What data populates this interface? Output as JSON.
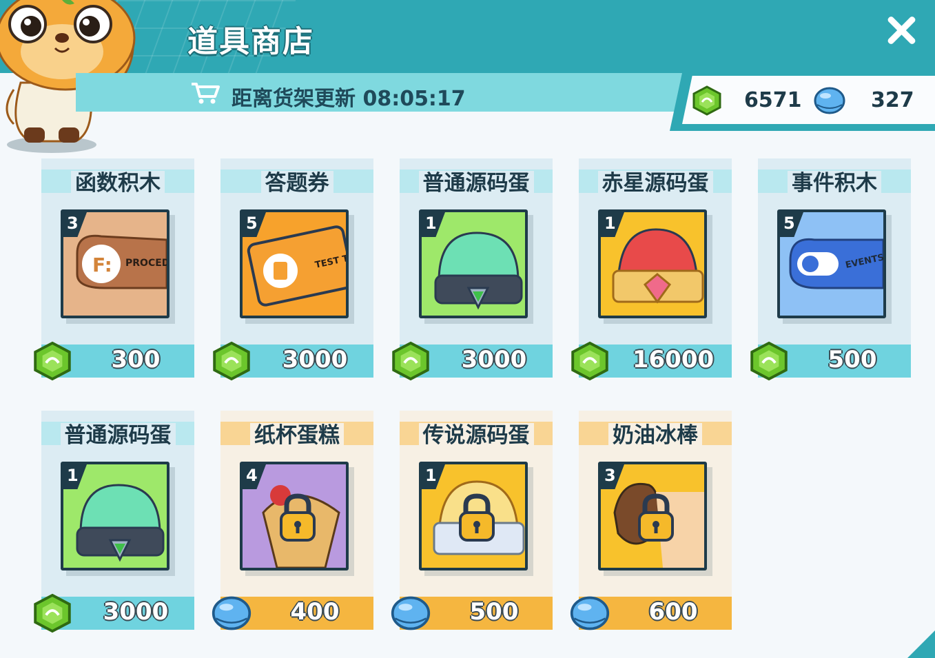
{
  "header": {
    "title": "道具商店",
    "refresh_text": "距离货架更新 08:05:17"
  },
  "currency": {
    "gems": "6571",
    "orbs": "327"
  },
  "colors": {
    "teal": "#2fa8b4",
    "light_teal": "#7fd9df",
    "price_blue": "#6fd3df",
    "price_orange": "#f5b640",
    "dark": "#1e3b49"
  },
  "items": [
    {
      "name": "函数积木",
      "count": "3",
      "price": "300",
      "currency_icon": "gem-icon",
      "locked": false
    },
    {
      "name": "答题券",
      "count": "5",
      "price": "3000",
      "currency_icon": "gem-icon",
      "locked": false
    },
    {
      "name": "普通源码蛋",
      "count": "1",
      "price": "3000",
      "currency_icon": "gem-icon",
      "locked": false
    },
    {
      "name": "赤星源码蛋",
      "count": "1",
      "price": "16000",
      "currency_icon": "gem-icon",
      "locked": false
    },
    {
      "name": "事件积木",
      "count": "5",
      "price": "500",
      "currency_icon": "gem-icon",
      "locked": false
    },
    {
      "name": "普通源码蛋",
      "count": "1",
      "price": "3000",
      "currency_icon": "gem-icon",
      "locked": false
    },
    {
      "name": "纸杯蛋糕",
      "count": "4",
      "price": "400",
      "currency_icon": "orb-icon",
      "locked": true
    },
    {
      "name": "传说源码蛋",
      "count": "1",
      "price": "500",
      "currency_icon": "orb-icon",
      "locked": true
    },
    {
      "name": "奶油冰棒",
      "count": "3",
      "price": "600",
      "currency_icon": "orb-icon",
      "locked": true
    }
  ],
  "item_art": {
    "0": "block-card-icon-text",
    "1": "ticket-card-icon-text"
  },
  "art_text": {
    "procedure": "PROCEDU",
    "test": "TEST TI",
    "events": "EVENTS"
  }
}
